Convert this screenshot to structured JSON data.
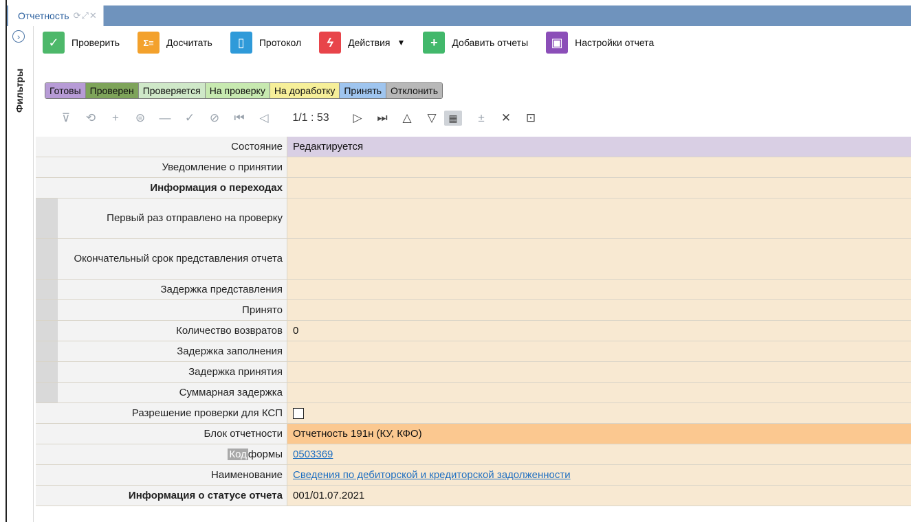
{
  "tab": {
    "title": "Отчетность",
    "controls": "⟳⤢✕"
  },
  "sidebar": {
    "filters_label": "Фильтры",
    "expand_glyph": "›"
  },
  "toolbar": {
    "check_label": "Проверить",
    "recalc_label": "Досчитать",
    "protocol_label": "Протокол",
    "actions_label": "Действия",
    "add_reports_label": "Добавить отчеты",
    "report_settings_label": "Настройки отчета"
  },
  "statuses": [
    {
      "label": "Готовы",
      "color": "#b79bd6"
    },
    {
      "label": "Проверен",
      "color": "#7ea45a"
    },
    {
      "label": "Проверяется",
      "color": "#cfe8c8"
    },
    {
      "label": "На проверку",
      "color": "#c7e9b0"
    },
    {
      "label": "На доработку",
      "color": "#f6ef99"
    },
    {
      "label": "Принять",
      "color": "#9fc5ef"
    },
    {
      "label": "Отклонить",
      "color": "#b8b8b8"
    }
  ],
  "nav": {
    "counter": "1/1 : 53"
  },
  "form": {
    "state_label": "Состояние",
    "state_value": "Редактируется",
    "notice_label": "Уведомление о принятии",
    "transitions_label": "Информация о переходах",
    "first_sent_label": "Первый раз отправлено на проверку",
    "deadline_label": "Окончательный срок представления отчета",
    "submit_delay_label": "Задержка представления",
    "accepted_label": "Принято",
    "returns_label": "Количество возвратов",
    "returns_value": "0",
    "fill_delay_label": "Задержка заполнения",
    "accept_delay_label": "Задержка принятия",
    "total_delay_label": "Суммарная задержка",
    "ksp_label": "Разрешение проверки для КСП",
    "block_label": "Блок отчетности",
    "block_value": "Отчетность 191н (КУ, КФО)",
    "code_label_hl": "Код",
    "code_label_rest": " формы",
    "code_value": "0503369",
    "name_label": "Наименование",
    "name_value": "Сведения по дебиторской и кредиторской задолженности",
    "status_info_label": "Информация о статусе отчета",
    "status_info_value": "001/01.07.2021"
  }
}
